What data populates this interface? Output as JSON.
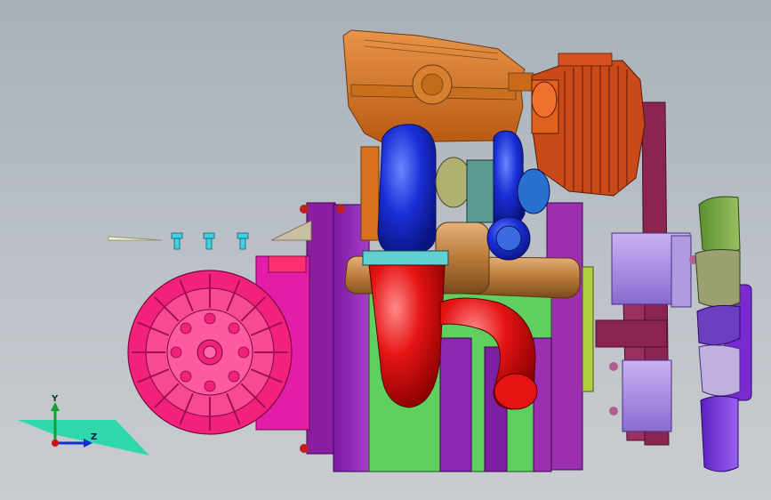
{
  "viewport": {
    "background_top": "#a9b0b8",
    "background_bottom": "#c9cdd1"
  },
  "triad": {
    "y_label": "Y",
    "z_label": "Z",
    "x_color": "#d01010",
    "y_color": "#10a030",
    "z_color": "#1030d0"
  },
  "model": {
    "components": [
      {
        "name": "flywheel",
        "color": "#f2217c"
      },
      {
        "name": "engine-block",
        "color": "#9b2fb0"
      },
      {
        "name": "oil-pan",
        "color": "#5fcf5f"
      },
      {
        "name": "turbocharger",
        "color": "#1a2fd6"
      },
      {
        "name": "exhaust-manifold",
        "color": "#e51414"
      },
      {
        "name": "intake-manifold",
        "color": "#d8701e"
      },
      {
        "name": "alternator",
        "color": "#d8501e"
      },
      {
        "name": "fan",
        "color": "#7a2ad0"
      },
      {
        "name": "pulley",
        "color": "#a080e0"
      },
      {
        "name": "belt",
        "color": "#8a2550"
      }
    ]
  }
}
